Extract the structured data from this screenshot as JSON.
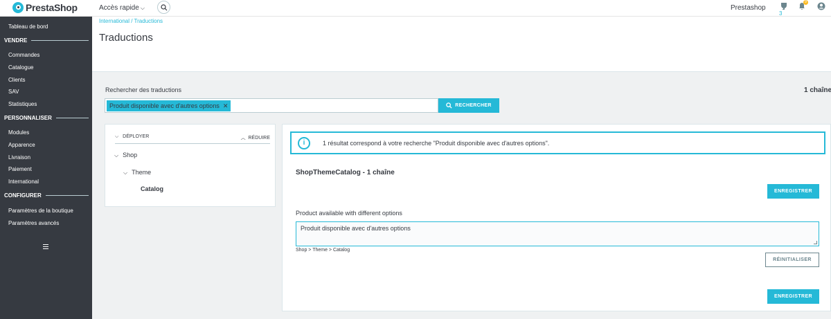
{
  "header": {
    "logo_text": "PrestaShop",
    "quick_access": "Accès rapide",
    "shop_name": "Prestashop",
    "orders_count": "3",
    "notifications_count": "9"
  },
  "sidebar": {
    "dashboard": "Tableau de bord",
    "section_sell": "VENDRE",
    "sell_items": [
      "Commandes",
      "Catalogue",
      "Clients",
      "SAV",
      "Statistiques"
    ],
    "section_customize": "PERSONNALISER",
    "customize_items": [
      "Modules",
      "Apparence",
      "Livraison",
      "Paiement",
      "International"
    ],
    "section_configure": "CONFIGURER",
    "configure_items": [
      "Paramètres de la boutique",
      "Paramètres avancés"
    ]
  },
  "breadcrumb": "International / Traductions",
  "page_title": "Traductions",
  "search": {
    "label": "Rechercher des traductions",
    "tag": "Produit disponible avec d'autres options",
    "button": "RECHERCHER",
    "total": "1 chaîne"
  },
  "tree": {
    "expand": "DÉPLOYER",
    "collapse": "RÉDUIRE",
    "nodes": [
      "Shop",
      "Theme",
      "Catalog"
    ]
  },
  "main": {
    "alert": "1 résultat correspond à votre recherche \"Produit disponible avec d'autres options\".",
    "domain_title": "ShopThemeCatalog - 1 chaîne",
    "save_label": "ENREGISTRER",
    "source_text": "Product available with different options",
    "translation": "Produit disponible avec d'autres options",
    "path": "Shop > Theme > Catalog",
    "reset_label": "RÉINITIALISER"
  },
  "colors": {
    "accent": "#25b9d7",
    "sidebar": "#363a41",
    "warning": "#fbbb22"
  }
}
